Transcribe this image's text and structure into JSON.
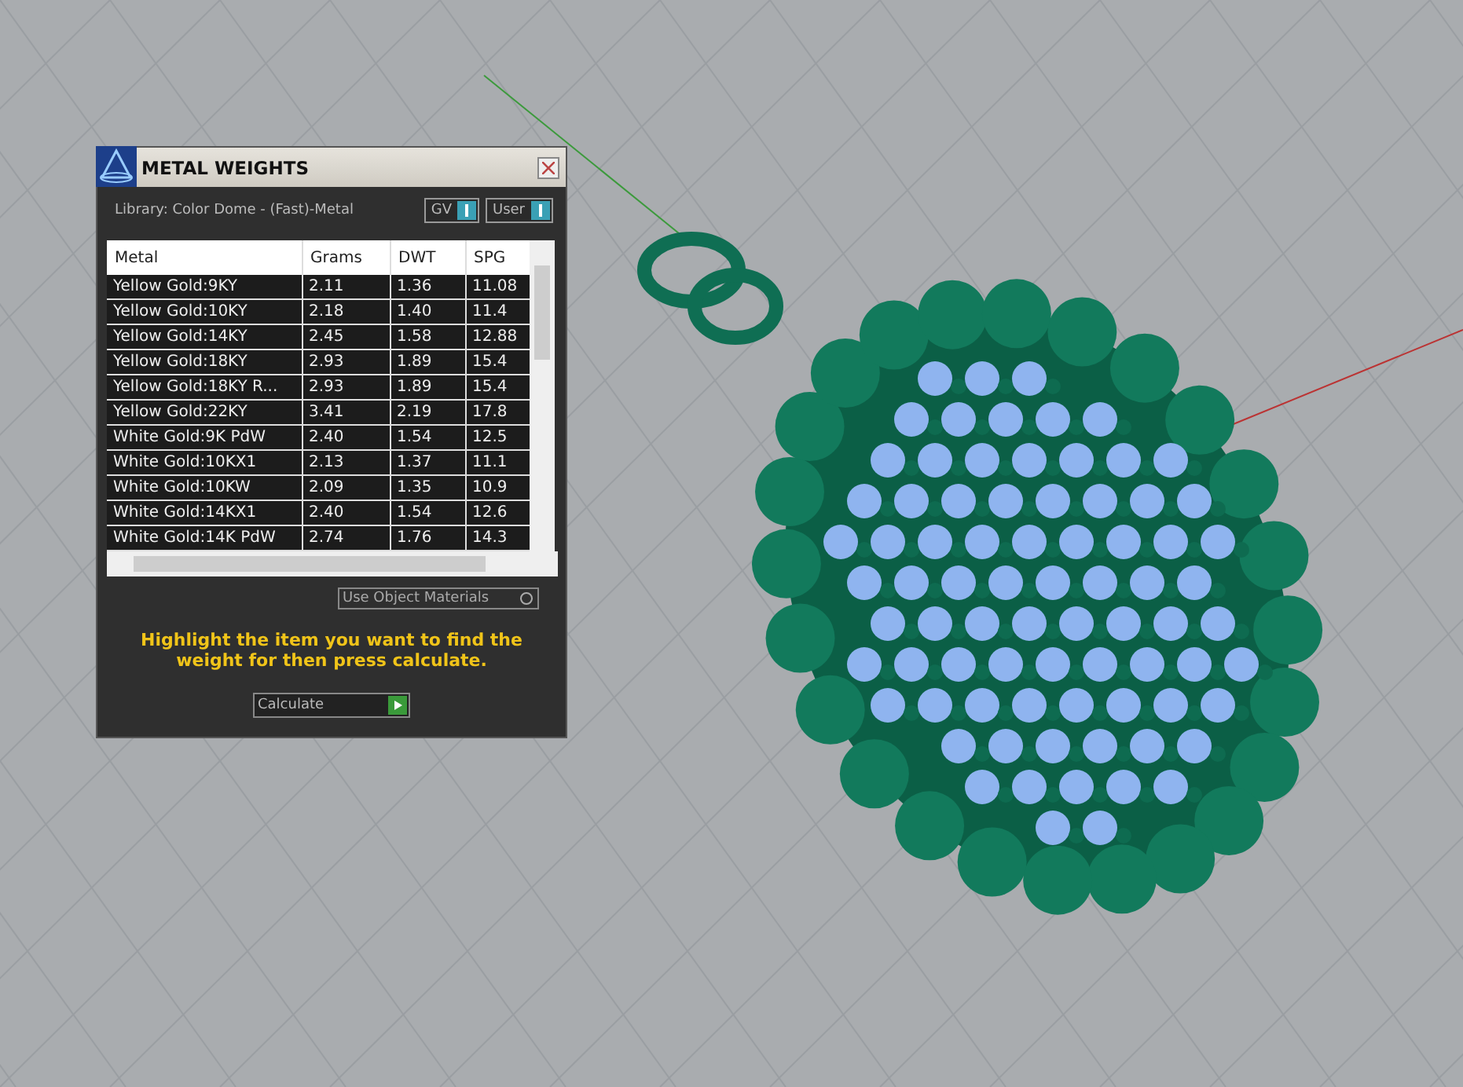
{
  "window": {
    "title": "METAL WEIGHTS"
  },
  "library": "Library: Color Dome - (Fast)-Metal",
  "toggles": [
    {
      "label": "GV",
      "on": true
    },
    {
      "label": "User",
      "on": true
    }
  ],
  "table": {
    "columns": [
      "Metal",
      "Grams",
      "DWT",
      "SPG"
    ],
    "rows": [
      [
        "Yellow Gold:9KY",
        "2.11",
        "1.36",
        "11.08"
      ],
      [
        "Yellow Gold:10KY",
        "2.18",
        "1.40",
        "11.4"
      ],
      [
        "Yellow Gold:14KY",
        "2.45",
        "1.58",
        "12.88"
      ],
      [
        "Yellow Gold:18KY",
        "2.93",
        "1.89",
        "15.4"
      ],
      [
        "Yellow Gold:18KY R...",
        "2.93",
        "1.89",
        "15.4"
      ],
      [
        "Yellow Gold:22KY",
        "3.41",
        "2.19",
        "17.8"
      ],
      [
        "White Gold:9K PdW",
        "2.40",
        "1.54",
        "12.5"
      ],
      [
        "White Gold:10KX1",
        "2.13",
        "1.37",
        "11.1"
      ],
      [
        "White Gold:10KW",
        "2.09",
        "1.35",
        "10.9"
      ],
      [
        "White Gold:14KX1",
        "2.40",
        "1.54",
        "12.6"
      ],
      [
        "White Gold:14K PdW",
        "2.74",
        "1.76",
        "14.3"
      ]
    ]
  },
  "use_object_materials": {
    "label": "Use Object Materials",
    "checked": false
  },
  "hint": "Highlight the item you want to find the weight for then press calculate.",
  "calculate_button": "Calculate"
}
